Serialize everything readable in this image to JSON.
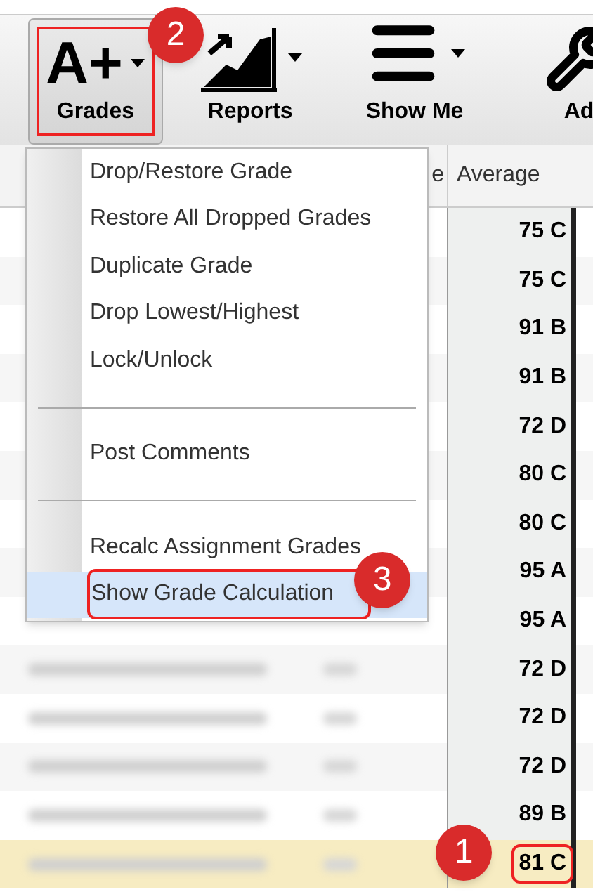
{
  "toolbar": {
    "buttons": [
      {
        "kind": "text-icon",
        "icon_text": "A+",
        "label": "Grades",
        "caret": true,
        "selected": true
      },
      {
        "kind": "chart",
        "label": "Reports",
        "caret": true,
        "selected": false
      },
      {
        "kind": "lines",
        "label": "Show Me",
        "caret": true,
        "selected": false
      },
      {
        "kind": "wrench",
        "label": "Ad",
        "caret": false,
        "selected": false
      }
    ]
  },
  "menu": {
    "items": [
      {
        "kind": "item",
        "label": "Drop/Restore Grade",
        "selected": false
      },
      {
        "kind": "item",
        "label": "Restore All Dropped Grades",
        "selected": false
      },
      {
        "kind": "item",
        "label": "Duplicate Grade",
        "selected": false
      },
      {
        "kind": "item",
        "label": "Drop Lowest/Highest",
        "selected": false
      },
      {
        "kind": "item",
        "label": "Lock/Unlock",
        "selected": false
      },
      {
        "kind": "separator"
      },
      {
        "kind": "item",
        "label": "Post Comments",
        "selected": false
      },
      {
        "kind": "separator"
      },
      {
        "kind": "item",
        "label": "Recalc Assignment Grades",
        "selected": false
      },
      {
        "kind": "item",
        "label": "Show Grade Calculation",
        "selected": true
      }
    ]
  },
  "table": {
    "columns": [
      "e",
      "Average"
    ],
    "rows": [
      {
        "average": "75 C",
        "selected": false
      },
      {
        "average": "75 C",
        "selected": false
      },
      {
        "average": "91 B",
        "selected": false
      },
      {
        "average": "91 B",
        "selected": false
      },
      {
        "average": "72 D",
        "selected": false
      },
      {
        "average": "80 C",
        "selected": false
      },
      {
        "average": "80 C",
        "selected": false
      },
      {
        "average": "95 A",
        "selected": false
      },
      {
        "average": "95 A",
        "selected": false
      },
      {
        "average": "72 D",
        "selected": false
      },
      {
        "average": "72 D",
        "selected": false
      },
      {
        "average": "72 D",
        "selected": false
      },
      {
        "average": "89 B",
        "selected": false
      },
      {
        "average": "81 C",
        "selected": true
      }
    ]
  },
  "callouts": [
    {
      "number": "2"
    },
    {
      "number": "3"
    },
    {
      "number": "1"
    }
  ]
}
